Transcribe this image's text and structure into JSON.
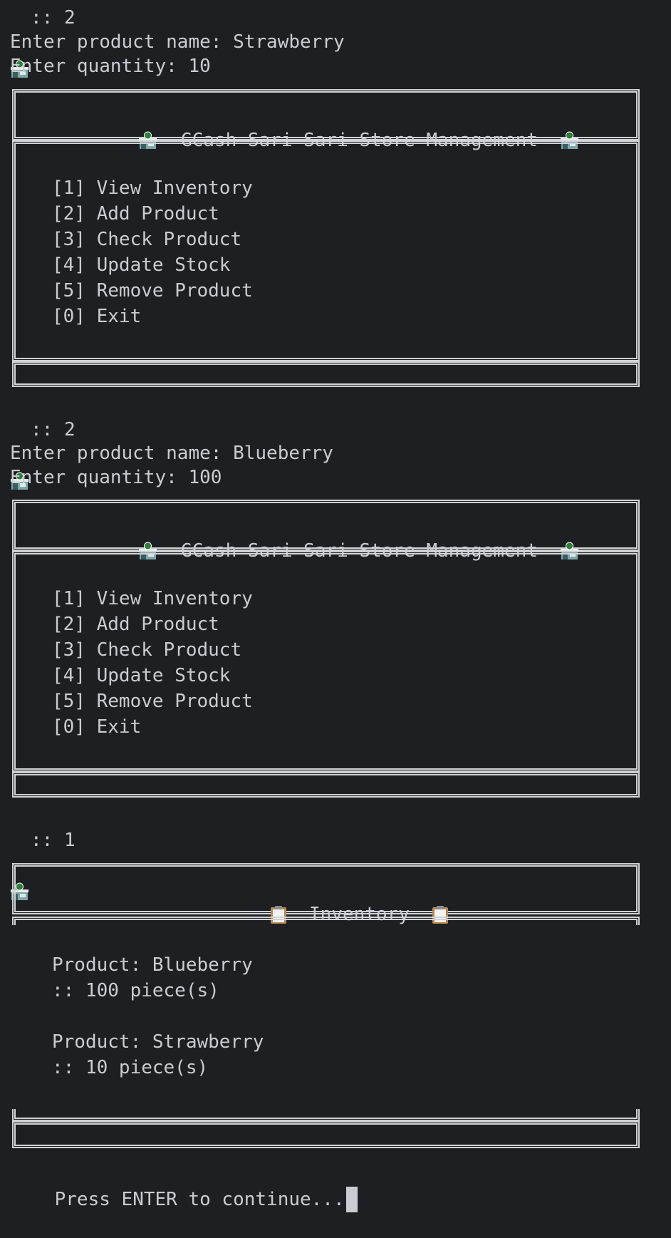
{
  "prompt_symbol": "::",
  "session": [
    {
      "choice": "2",
      "name_prompt": "Enter product name:",
      "name_value": "Strawberry",
      "qty_prompt": "Enter quantity:",
      "qty_value": "10"
    },
    {
      "choice": "2",
      "name_prompt": "Enter product name:",
      "name_value": "Blueberry",
      "qty_prompt": "Enter quantity:",
      "qty_value": "100"
    },
    {
      "choice": "1"
    }
  ],
  "menu": {
    "title": "GCash Sari-Sari Store Management",
    "items": [
      {
        "key": "[1]",
        "label": "View Inventory"
      },
      {
        "key": "[2]",
        "label": "Add Product"
      },
      {
        "key": "[3]",
        "label": "Check Product"
      },
      {
        "key": "[4]",
        "label": "Update Stock"
      },
      {
        "key": "[5]",
        "label": "Remove Product"
      },
      {
        "key": "[0]",
        "label": "Exit"
      }
    ]
  },
  "inventory": {
    "title": "Inventory",
    "products": [
      {
        "product_label": "Product:",
        "name": "Blueberry",
        "qty_line": ":: 100 piece(s)"
      },
      {
        "product_label": "Product:",
        "name": "Strawberry",
        "qty_line": ":: 10 piece(s)"
      }
    ]
  },
  "footer_prompt": "Press ENTER to continue...",
  "icons": {
    "prompt": "convenience-store-icon",
    "inventory": "clipboard-icon"
  },
  "colors": {
    "background": "#1e1f22",
    "text": "#c9ccd3",
    "frame": "#cfd2d6"
  }
}
